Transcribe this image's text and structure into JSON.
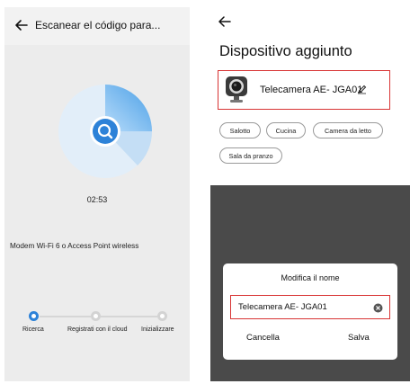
{
  "left_screen": {
    "title": "Escanear el código para...",
    "timer": "02:53",
    "network_note": "Modem Wi-Fi 6 o Access Point wireless",
    "steps": [
      {
        "label": "Ricerca",
        "state": "active"
      },
      {
        "label": "Registrati con il cloud",
        "state": "inactive"
      },
      {
        "label": "Inizializzare",
        "state": "inactive"
      }
    ],
    "accent_color": "#2d82d8"
  },
  "right_screen": {
    "heading": "Dispositivo aggiunto",
    "device_name": "Telecamera AE- JGA01",
    "rooms": [
      "Salotto",
      "Cucina",
      "Camera da letto",
      "Sala da pranzo"
    ],
    "dialog": {
      "title": "Modifica il nome",
      "input_value": "Telecamera AE- JGA01",
      "cancel_label": "Cancella",
      "save_label": "Salva"
    },
    "highlight_color": "#d83434"
  }
}
